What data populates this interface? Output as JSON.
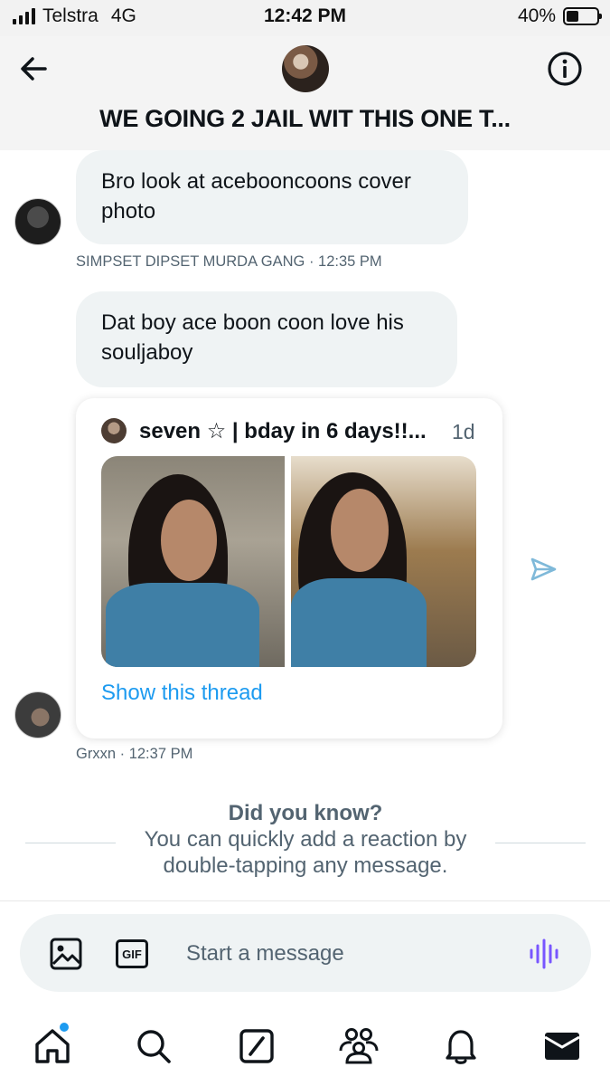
{
  "status_bar": {
    "carrier": "Telstra",
    "network": "4G",
    "time": "12:42 PM",
    "battery": "40%",
    "battery_level": 0.4
  },
  "header": {
    "title": "WE GOING 2 JAIL WIT THIS ONE T..."
  },
  "messages": [
    {
      "text": "Bro look at acebooncoons cover photo",
      "sender": "SIMPSET DIPSET MURDA GANG",
      "time": "12:35 PM"
    },
    {
      "text": "Dat boy ace boon coon love his souljaboy"
    }
  ],
  "shared_tweet": {
    "author": "seven ☆ | bday in 6 days!!...",
    "age": "1d",
    "show_thread": "Show this thread",
    "sender": "Grxxn",
    "time": "12:37 PM"
  },
  "tip": {
    "title": "Did you know?",
    "body": "You can quickly add a reaction by double-tapping any message."
  },
  "composer": {
    "placeholder": "Start a message",
    "gif_label": "GIF"
  },
  "colors": {
    "accent": "#1d9bf0",
    "bubble": "#eff3f4",
    "secondary_text": "#536471",
    "voice": "#7856ff"
  },
  "nav": [
    "home-icon",
    "search-icon",
    "compose-icon",
    "communities-icon",
    "notifications-icon",
    "messages-icon"
  ]
}
